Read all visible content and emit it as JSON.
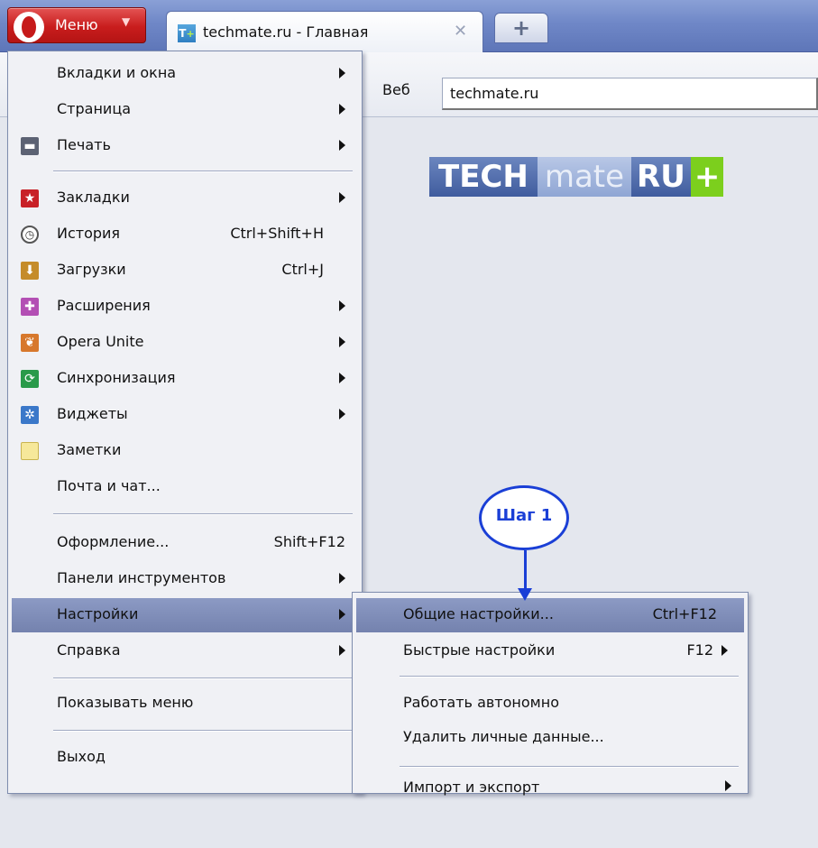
{
  "tab_bar": {
    "menu_button": "Меню",
    "tab_title": "techmate.ru - Главная",
    "favicon_text": "T",
    "favicon_plus": "+",
    "close_glyph": "✕",
    "new_tab_glyph": "+"
  },
  "address_bar": {
    "search_label": "Веб",
    "url": "techmate.ru"
  },
  "page": {
    "logo_parts": [
      "TECH",
      "mate",
      "RU",
      "+"
    ]
  },
  "main_menu": [
    {
      "label": "Вкладки и окна",
      "submenu": true
    },
    {
      "label": "Страница",
      "submenu": true
    },
    {
      "label": "Печать",
      "submenu": true,
      "icon": "printer-icon"
    },
    {
      "label": "Закладки",
      "submenu": true,
      "icon": "bookmarks-icon"
    },
    {
      "label": "История",
      "shortcut": "Ctrl+Shift+H",
      "icon": "history-icon"
    },
    {
      "label": "Загрузки",
      "shortcut": "Ctrl+J",
      "icon": "downloads-icon"
    },
    {
      "label": "Расширения",
      "submenu": true,
      "icon": "extensions-icon"
    },
    {
      "label": "Opera Unite",
      "submenu": true,
      "icon": "unite-icon"
    },
    {
      "label": "Синхронизация",
      "submenu": true,
      "icon": "sync-icon"
    },
    {
      "label": "Виджеты",
      "submenu": true,
      "icon": "widgets-icon"
    },
    {
      "label": "Заметки",
      "icon": "notes-icon"
    },
    {
      "label": "Почта и чат..."
    },
    {
      "label": "Оформление...",
      "shortcut": "Shift+F12"
    },
    {
      "label": "Панели инструментов",
      "submenu": true
    },
    {
      "label": "Настройки",
      "submenu": true,
      "highlighted": true
    },
    {
      "label": "Справка",
      "submenu": true
    },
    {
      "label": "Показывать меню"
    },
    {
      "label": "Выход"
    }
  ],
  "settings_submenu": [
    {
      "label": "Общие настройки...",
      "shortcut": "Ctrl+F12",
      "highlighted": true
    },
    {
      "label": "Быстрые настройки",
      "shortcut": "F12",
      "submenu": true
    },
    {
      "label": "Работать автономно"
    },
    {
      "label": "Удалить личные данные..."
    },
    {
      "label": "Импорт и экспорт",
      "submenu": true
    }
  ],
  "callout": {
    "label": "Шаг 1"
  },
  "colors": {
    "highlight": "#7d8ab5",
    "menu_bg": "#f0f1f5",
    "callout": "#1a3fd6",
    "opera_red": "#c91d1d"
  }
}
